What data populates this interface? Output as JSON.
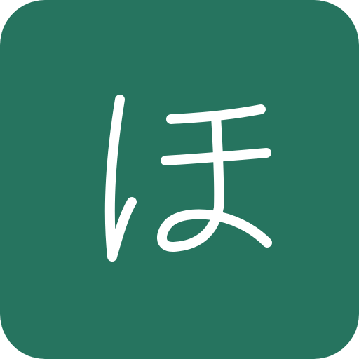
{
  "tile": {
    "glyph": "ほ",
    "background_color": "#26745F",
    "glyph_color": "#FFFFFF",
    "icon": "hiragana-ho-icon"
  }
}
